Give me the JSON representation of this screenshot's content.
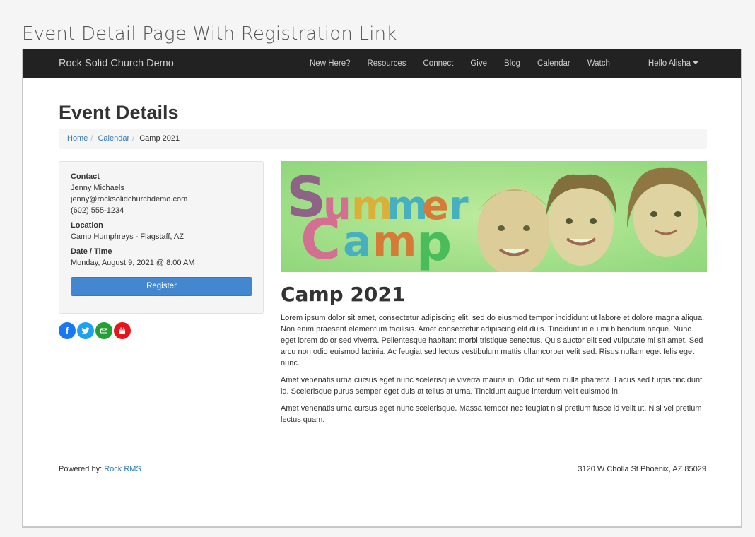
{
  "caption": "Event Detail Page With Registration Link",
  "navbar": {
    "brand": "Rock Solid Church Demo",
    "items": [
      "New Here?",
      "Resources",
      "Connect",
      "Give",
      "Blog",
      "Calendar",
      "Watch"
    ],
    "user": "Hello Alisha"
  },
  "page": {
    "title": "Event Details"
  },
  "breadcrumb": {
    "items": [
      "Home",
      "Calendar"
    ],
    "active": "Camp 2021"
  },
  "info": {
    "contact_label": "Contact",
    "contact_name": "Jenny Michaels",
    "contact_email": "jenny@rocksolidchurchdemo.com",
    "contact_phone": "(602) 555-1234",
    "location_label": "Location",
    "location_value": "Camp Humphreys - Flagstaff, AZ",
    "datetime_label": "Date / Time",
    "datetime_value": "Monday, August 9, 2021 @ 8:00 AM",
    "register_label": "Register"
  },
  "share": [
    {
      "icon": "facebook-icon",
      "glyph": "f",
      "color": "#1877f2"
    },
    {
      "icon": "twitter-icon",
      "glyph": "🐦",
      "color": "#1da1f2"
    },
    {
      "icon": "email-icon",
      "glyph": "✉",
      "color": "#22a033"
    },
    {
      "icon": "calendar-icon",
      "glyph": "▦",
      "color": "#e8141c"
    }
  ],
  "banner": {
    "word1": "Summer",
    "word2": "Camp",
    "colors": [
      "#8a3a8a",
      "#e64a98",
      "#f2a020",
      "#2aa0d8",
      "#e85a20",
      "#30b050",
      "#f5c816"
    ]
  },
  "event": {
    "title": "Camp 2021",
    "paragraphs": [
      "Lorem ipsum dolor sit amet, consectetur adipiscing elit, sed do eiusmod tempor incididunt ut labore et dolore magna aliqua. Non enim praesent elementum facilisis. Amet consectetur adipiscing elit duis. Tincidunt in eu mi bibendum neque. Nunc eget lorem dolor sed viverra. Pellentesque habitant morbi tristique senectus. Quis auctor elit sed vulputate mi sit amet. Sed arcu non odio euismod lacinia. Ac feugiat sed lectus vestibulum mattis ullamcorper velit sed. Risus nullam eget felis eget nunc.",
      "Amet venenatis urna cursus eget nunc scelerisque viverra mauris in. Odio ut sem nulla pharetra. Lacus sed turpis tincidunt id. Scelerisque purus semper eget duis at tellus at urna. Tincidunt augue interdum velit euismod in.",
      "Amet venenatis urna cursus eget nunc scelerisque. Massa tempor nec feugiat nisl pretium fusce id velit ut. Nisl vel pretium lectus quam."
    ]
  },
  "footer": {
    "powered_prefix": "Powered by: ",
    "powered_link": "Rock RMS",
    "address": "3120 W Cholla St Phoenix, AZ 85029"
  }
}
